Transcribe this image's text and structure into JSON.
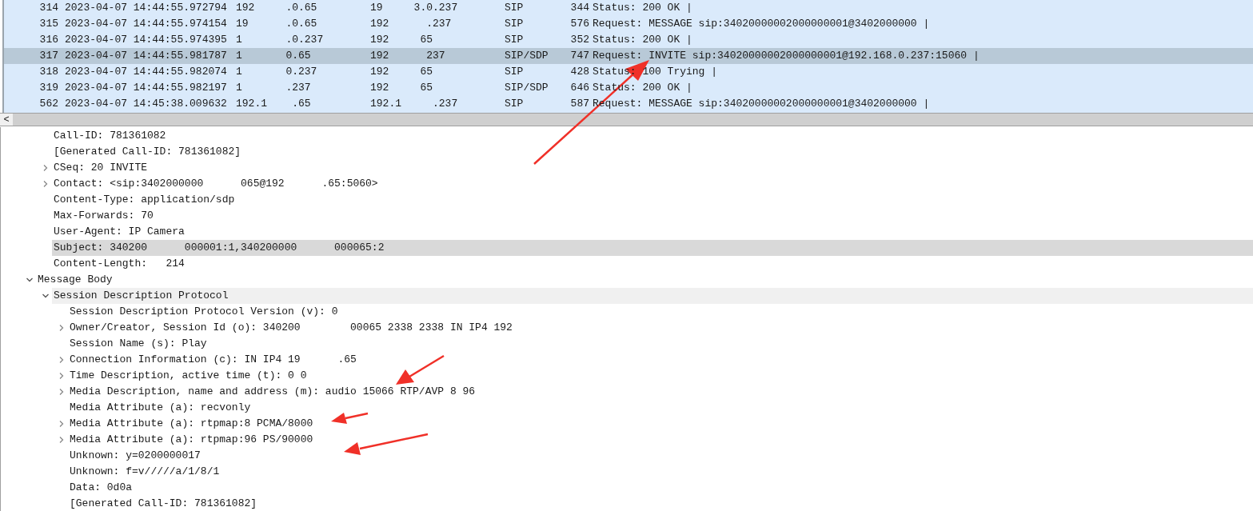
{
  "packet_list": {
    "rows": [
      {
        "no": "314",
        "time": "2023-04-07 14:44:55.972794",
        "source": "192     .0.65",
        "destination": "19     3.0.237",
        "protocol": "SIP",
        "length": "344",
        "info": "Status: 200 OK |",
        "selected": false
      },
      {
        "no": "315",
        "time": "2023-04-07 14:44:55.974154",
        "source": "19      .0.65",
        "destination": "192      .237",
        "protocol": "SIP",
        "length": "576",
        "info": "Request: MESSAGE sip:34020000002000000001@3402000000 |",
        "selected": false
      },
      {
        "no": "316",
        "time": "2023-04-07 14:44:55.974395",
        "source": "1       .0.237",
        "destination": "192     65",
        "protocol": "SIP",
        "length": "352",
        "info": "Status: 200 OK |",
        "selected": false
      },
      {
        "no": "317",
        "time": "2023-04-07 14:44:55.981787",
        "source": "1       0.65",
        "destination": "192      237",
        "protocol": "SIP/SDP",
        "length": "747",
        "info": "Request: INVITE sip:34020000002000000001@192.168.0.237:15060 |",
        "selected": true
      },
      {
        "no": "318",
        "time": "2023-04-07 14:44:55.982074",
        "source": "1       0.237",
        "destination": "192     65",
        "protocol": "SIP",
        "length": "428",
        "info": "Status: 100 Trying |",
        "selected": false
      },
      {
        "no": "319",
        "time": "2023-04-07 14:44:55.982197",
        "source": "1       .237",
        "destination": "192     65",
        "protocol": "SIP/SDP",
        "length": "646",
        "info": "Status: 200 OK |",
        "selected": false
      },
      {
        "no": "562",
        "time": "2023-04-07 14:45:38.009632",
        "source": "192.1    .65",
        "destination": "192.1     .237",
        "protocol": "SIP",
        "length": "587",
        "info": "Request: MESSAGE sip:34020000002000000001@3402000000 |",
        "selected": false
      }
    ],
    "scroll_left": "<"
  },
  "sip_headers": [
    {
      "label": "Call-ID: 781361082",
      "selected": false
    },
    {
      "label": "[Generated Call-ID: 781361082]",
      "selected": false
    },
    {
      "label": "CSeq: 20 INVITE",
      "expanded": false,
      "selected": false
    },
    {
      "label": "Contact: <sip:3402000000      065@192      .65:5060>",
      "expanded": false,
      "selected": false
    },
    {
      "label": "Content-Type: application/sdp",
      "selected": false
    },
    {
      "label": "Max-Forwards: 70",
      "selected": false
    },
    {
      "label": "User-Agent: IP Camera",
      "selected": false
    },
    {
      "label": "Subject: 340200      000001:1,340200000      000065:2",
      "selected": true
    },
    {
      "label": "Content-Length:   214",
      "selected": false
    }
  ],
  "tree": [
    {
      "label": "Message Body",
      "expanded": true,
      "selected": false,
      "children": [
        {
          "label": "Session Description Protocol",
          "expanded": true,
          "selected": false,
          "highlighted": true,
          "children": [
            {
              "label": "Session Description Protocol Version (v): 0",
              "selected": false
            },
            {
              "label": "Owner/Creator, Session Id (o): 340200        00065 2338 2338 IN IP4 192",
              "expanded": false,
              "selected": false
            },
            {
              "label": "Session Name (s): Play",
              "selected": false
            },
            {
              "label": "Connection Information (c): IN IP4 19      .65",
              "expanded": false,
              "selected": false
            },
            {
              "label": "Time Description, active time (t): 0 0",
              "expanded": false,
              "selected": false
            },
            {
              "label": "Media Description, name and address (m): audio 15066 RTP/AVP 8 96",
              "expanded": false,
              "selected": false
            },
            {
              "label": "Media Attribute (a): recvonly",
              "selected": false
            },
            {
              "label": "Media Attribute (a): rtpmap:8 PCMA/8000",
              "expanded": false,
              "selected": false
            },
            {
              "label": "Media Attribute (a): rtpmap:96 PS/90000",
              "expanded": false,
              "selected": false
            },
            {
              "label": "Unknown: y=0200000017",
              "selected": false
            },
            {
              "label": "Unknown: f=v/////a/1/8/1",
              "selected": false
            },
            {
              "label": "Data: 0d0a",
              "selected": false
            },
            {
              "label": "[Generated Call-ID: 781361082]",
              "selected": false
            }
          ]
        }
      ]
    }
  ]
}
